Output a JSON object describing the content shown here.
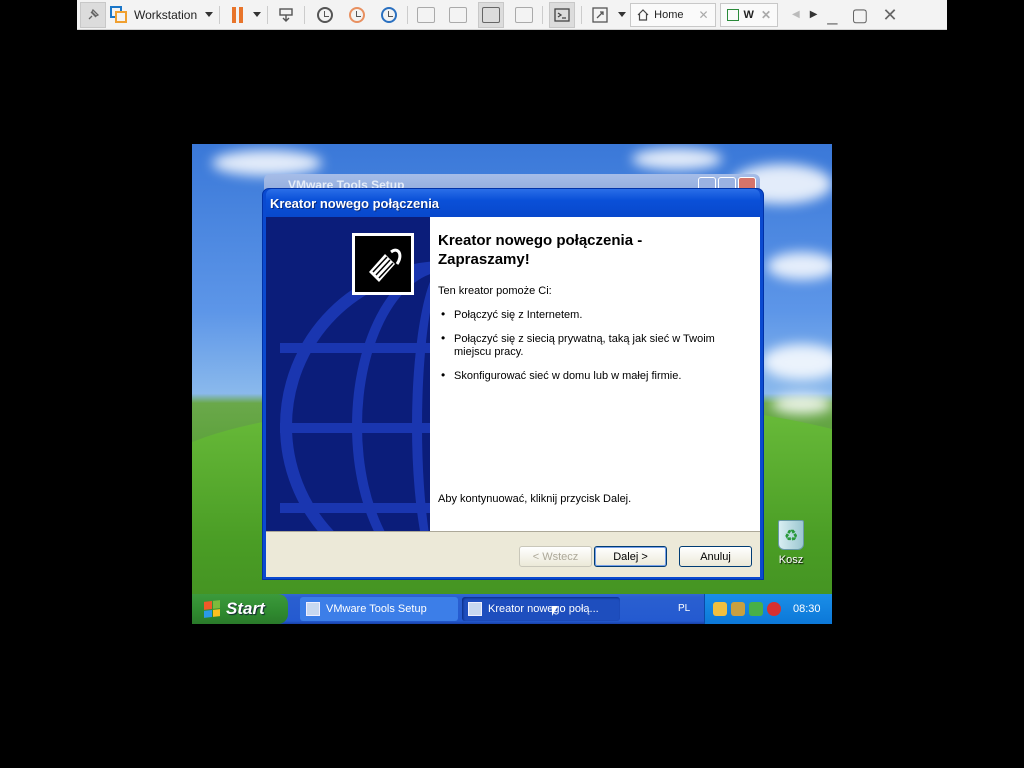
{
  "vmware": {
    "product_label": "Workstation",
    "tabs": [
      {
        "label": "Home",
        "icon": "home-icon"
      },
      {
        "label": "W",
        "icon": "vm-icon"
      }
    ]
  },
  "guest": {
    "background_window": {
      "title": "VMware Tools Setup"
    },
    "wizard": {
      "title": "Kreator nowego połączenia",
      "heading": "Kreator nowego połączenia - Zapraszamy!",
      "intro": "Ten kreator pomoże Ci:",
      "bullets": [
        "Połączyć się z Internetem.",
        "Połączyć się z siecią prywatną, taką jak sieć w Twoim miejscu pracy.",
        "Skonfigurować sieć w domu lub w małej firmie."
      ],
      "footer": "Aby kontynuować, kliknij przycisk Dalej.",
      "buttons": {
        "back": "< Wstecz",
        "next": "Dalej >",
        "cancel": "Anuluj"
      }
    },
    "desktop": {
      "recycle_bin_label": "Kosz"
    },
    "taskbar": {
      "start_label": "Start",
      "tasks": [
        {
          "label": "VMware Tools Setup",
          "active": false
        },
        {
          "label": "Kreator nowego połą...",
          "active": true
        }
      ],
      "language": "PL",
      "clock": "08:30"
    }
  },
  "colors": {
    "xp_title": "#0a50d8",
    "taskbar": "#245ad0",
    "tray": "#0c78d8",
    "start": "#2f8a2f"
  }
}
